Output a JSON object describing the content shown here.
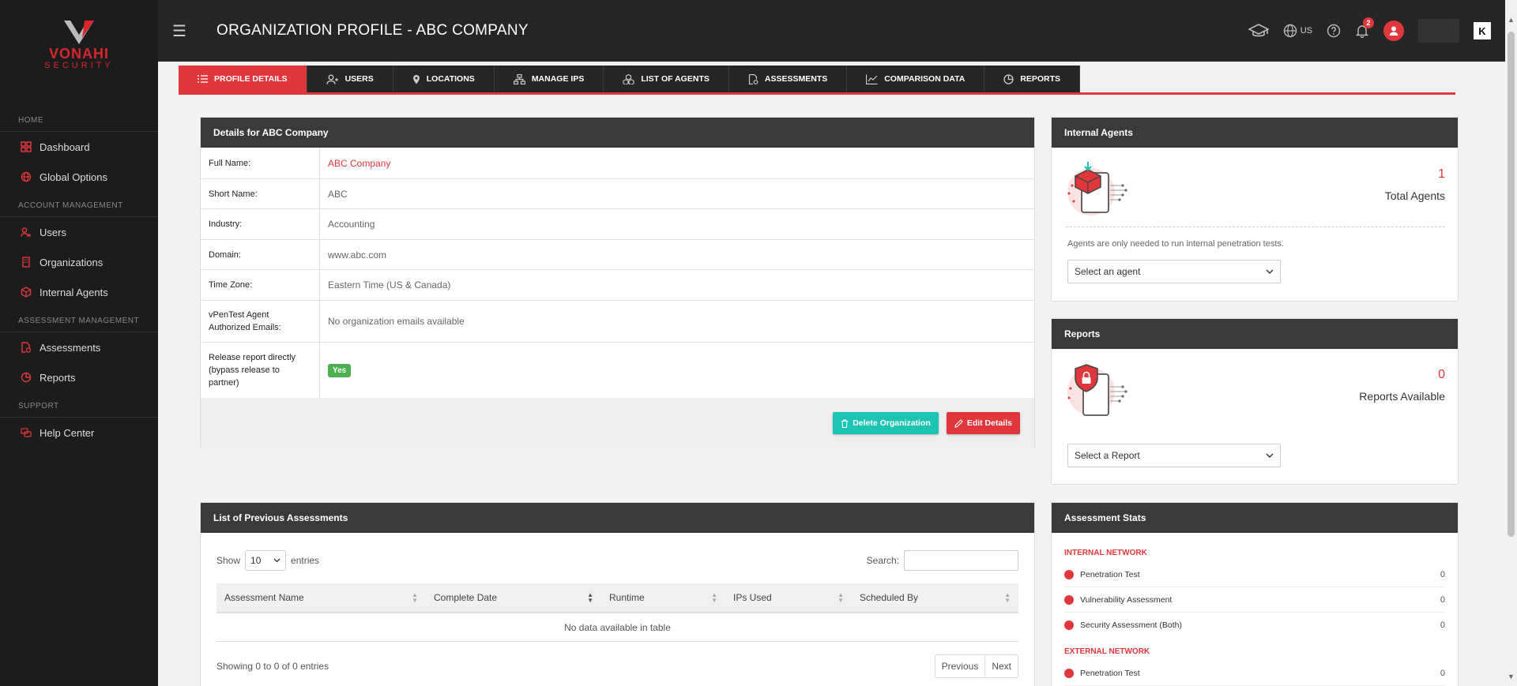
{
  "brand": {
    "line1": "VONAHI",
    "line2": "SECURITY"
  },
  "sidebar": {
    "sections": [
      {
        "heading": "HOME",
        "items": [
          {
            "label": "Dashboard"
          },
          {
            "label": "Global Options"
          }
        ]
      },
      {
        "heading": "ACCOUNT MANAGEMENT",
        "items": [
          {
            "label": "Users"
          },
          {
            "label": "Organizations"
          },
          {
            "label": "Internal Agents"
          }
        ]
      },
      {
        "heading": "ASSESSMENT MANAGEMENT",
        "items": [
          {
            "label": "Assessments"
          },
          {
            "label": "Reports"
          }
        ]
      },
      {
        "heading": "SUPPORT",
        "items": [
          {
            "label": "Help Center"
          }
        ]
      }
    ]
  },
  "header": {
    "title": "ORGANIZATION PROFILE - ABC COMPANY",
    "language": "US",
    "notifications_count": "2",
    "corner_logo": "K"
  },
  "tabs": [
    {
      "label": "PROFILE DETAILS"
    },
    {
      "label": "USERS"
    },
    {
      "label": "LOCATIONS"
    },
    {
      "label": "MANAGE IPS"
    },
    {
      "label": "LIST OF AGENTS"
    },
    {
      "label": "ASSESSMENTS"
    },
    {
      "label": "COMPARISON DATA"
    },
    {
      "label": "REPORTS"
    }
  ],
  "details": {
    "heading": "Details for ABC Company",
    "rows": [
      {
        "label": "Full Name:",
        "value": "ABC Company"
      },
      {
        "label": "Short Name:",
        "value": "ABC"
      },
      {
        "label": "Industry:",
        "value": "Accounting"
      },
      {
        "label": "Domain:",
        "value": "www.abc.com"
      },
      {
        "label": "Time Zone:",
        "value": "Eastern Time (US & Canada)"
      },
      {
        "label": "vPenTest Agent Authorized Emails:",
        "value": "No organization emails available"
      },
      {
        "label": "Release report directly (bypass release to partner)",
        "value": "Yes"
      }
    ],
    "delete_label": "Delete Organization",
    "edit_label": "Edit Details"
  },
  "agents": {
    "heading": "Internal Agents",
    "count": "1",
    "count_label": "Total Agents",
    "hint": "Agents are only needed to run internal penetration tests.",
    "select_label": "Select an agent"
  },
  "reports": {
    "heading": "Reports",
    "count": "0",
    "count_label": "Reports Available",
    "select_label": "Select a Report"
  },
  "stats": {
    "heading": "Assessment Stats",
    "internal_heading": "INTERNAL NETWORK",
    "internal": [
      {
        "label": "Penetration Test",
        "value": "0"
      },
      {
        "label": "Vulnerability Assessment",
        "value": "0"
      },
      {
        "label": "Security Assessment (Both)",
        "value": "0"
      }
    ],
    "external_heading": "EXTERNAL NETWORK",
    "external": [
      {
        "label": "Penetration Test",
        "value": "0"
      }
    ]
  },
  "previous": {
    "heading": "List of Previous Assessments",
    "show_label": "Show",
    "page_length": "10",
    "entries_label": "entries",
    "search_label": "Search:",
    "columns": [
      "Assessment Name",
      "Complete Date",
      "Runtime",
      "IPs Used",
      "Scheduled By"
    ],
    "empty": "No data available in table",
    "info": "Showing 0 to 0 of 0 entries",
    "prev_label": "Previous",
    "next_label": "Next"
  },
  "colors": {
    "accent": "#e0373c",
    "teal": "#1ec4b3",
    "sidebar": "#1c1c1c",
    "topbar": "#262626"
  }
}
